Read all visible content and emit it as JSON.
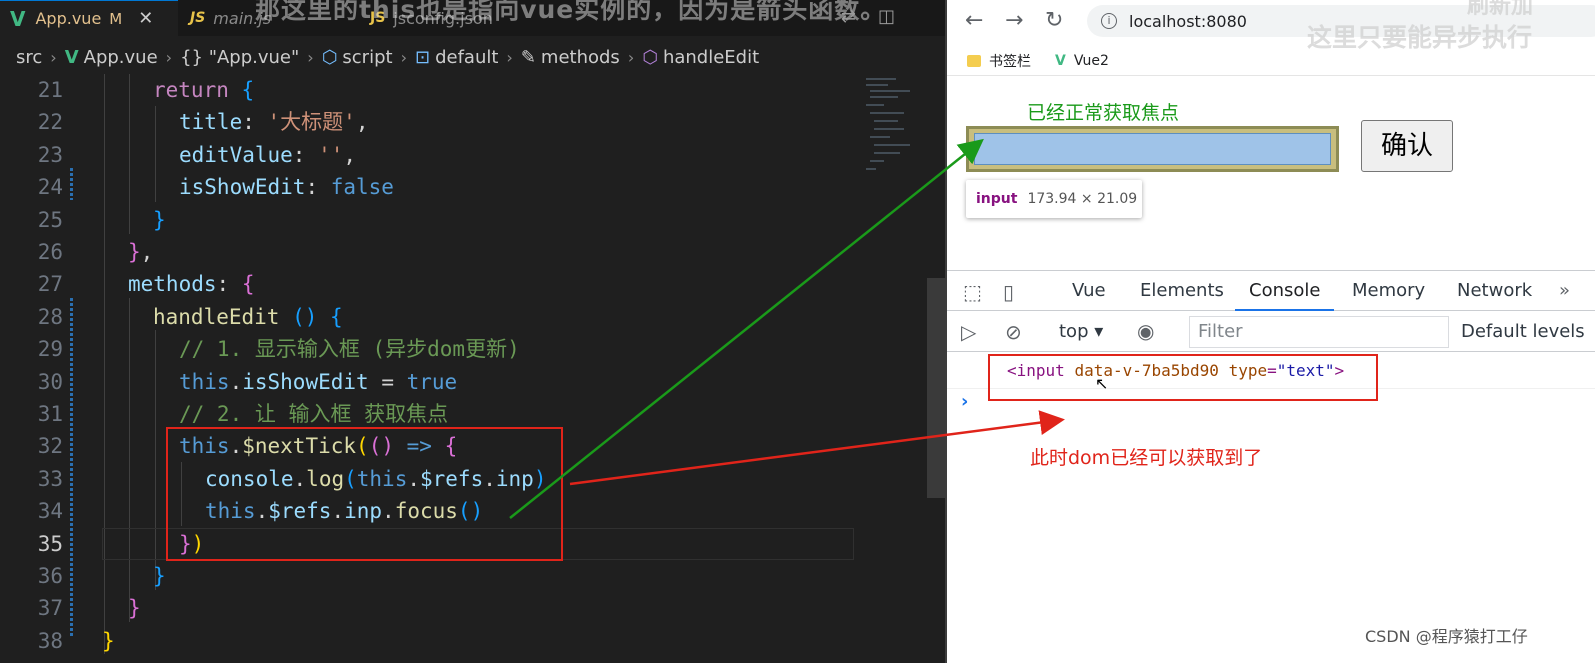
{
  "editor": {
    "tabs": [
      {
        "icon": "vue-file-icon",
        "label": "App.vue",
        "modified": "M",
        "close": "✕"
      },
      {
        "icon": "js-file-icon",
        "label": "main.js"
      },
      {
        "icon": "js-file-icon",
        "label": "jsconfig.json"
      }
    ],
    "overlay_caption": "那这里的this也是指向vue实例的，因为是箭头函数。",
    "breadcrumb": [
      "src",
      "App.vue",
      "{} \"App.vue\"",
      "script",
      "default",
      "methods",
      "handleEdit"
    ],
    "lines": [
      {
        "n": "21"
      },
      {
        "n": "22"
      },
      {
        "n": "23"
      },
      {
        "n": "24"
      },
      {
        "n": "25"
      },
      {
        "n": "26"
      },
      {
        "n": "27"
      },
      {
        "n": "28"
      },
      {
        "n": "29"
      },
      {
        "n": "30"
      },
      {
        "n": "31"
      },
      {
        "n": "32"
      },
      {
        "n": "33"
      },
      {
        "n": "34"
      },
      {
        "n": "35"
      },
      {
        "n": "36"
      },
      {
        "n": "37"
      },
      {
        "n": "38"
      }
    ],
    "code": {
      "l21_return": "return",
      "l22_key": "title",
      "l22_val": "'大标题'",
      "l23_key": "editValue",
      "l23_val": "''",
      "l24_key": "isShowEdit",
      "l24_val": "false",
      "l27_key": "methods",
      "l28_fn": "handleEdit",
      "l29_comment": "// 1. 显示输入框 (异步dom更新)",
      "l30_this": "this",
      "l30_prop": "isShowEdit",
      "l30_val": "true",
      "l31_comment": "// 2. 让 输入框 获取焦点",
      "l32_this": "this",
      "l32_fn": "$nextTick",
      "l33_obj": "console",
      "l33_fn": "log",
      "l33_this": "this",
      "l33_refs": "$refs",
      "l33_inp": "inp",
      "l34_this": "this",
      "l34_refs": "$refs",
      "l34_inp": "inp",
      "l34_fn": "focus"
    }
  },
  "browser": {
    "url": "localhost:8080",
    "overlay_caption": "这里只要能异步执行",
    "overlay_caption_top": "刷新加",
    "bookmarks": [
      {
        "icon": "folder-icon",
        "label": "书签栏"
      },
      {
        "icon": "vue-logo-icon",
        "label": "Vue2"
      }
    ],
    "page": {
      "green_note": "已经正常获取焦点",
      "confirm_button": "确认",
      "tooltip_tag": "input",
      "tooltip_dims": "173.94 × 21.09"
    },
    "devtools": {
      "tabs": [
        "Vue",
        "Elements",
        "Console",
        "Memory",
        "Network"
      ],
      "active_tab": "Console",
      "context": "top",
      "filter_placeholder": "Filter",
      "levels": "Default levels",
      "console_output": {
        "tag_open": "<input",
        "attr1": "data-v-7ba5bd90",
        "attr2_name": "type",
        "attr2_val": "\"text\"",
        "tag_close": ">"
      },
      "prompt": "›",
      "red_note": "此时dom已经可以获取到了"
    },
    "watermark": "CSDN @程序猿打工仔"
  },
  "colors": {
    "annotation_red": "#e0241a",
    "annotation_green": "#1a9a1a",
    "vue_green": "#41b883",
    "devtools_blue": "#1a73e8"
  }
}
